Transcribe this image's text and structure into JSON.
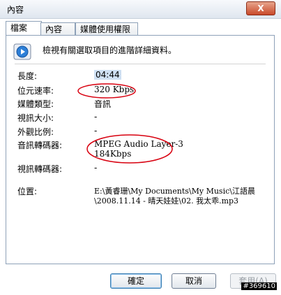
{
  "window": {
    "title": "內容",
    "close_glyph": "X"
  },
  "tabs": [
    {
      "label": "檔案",
      "active": true
    },
    {
      "label": "內容",
      "active": false
    },
    {
      "label": "媒體使用權限",
      "active": false
    }
  ],
  "panel": {
    "description": "檢視有關選取項目的進階詳細資料。",
    "icon": "media-player-icon",
    "rows": [
      {
        "label": "長度:",
        "value": "04:44"
      },
      {
        "label": "位元速率:",
        "value": "320 Kbps"
      },
      {
        "label": "媒體類型:",
        "value": "音訊"
      },
      {
        "label": "視訊大小:",
        "value": "-"
      },
      {
        "label": "外觀比例:",
        "value": "-"
      },
      {
        "label": "音訊轉碼器:",
        "value": "MPEG Audio Layer-3",
        "value2": "184Kbps"
      },
      {
        "label": "視訊轉碼器:",
        "value": "-"
      },
      {
        "label": "位置:",
        "value": "E:\\黃睿珊\\My Documents\\My Music\\江語晨",
        "value2": "\\2008.11.14 - 晴天娃娃\\02. 我太乖.mp3"
      }
    ]
  },
  "buttons": {
    "ok": "確定",
    "cancel": "取消",
    "apply": "套用(A)"
  },
  "watermark": "#369610",
  "colors": {
    "annotation": "#d8000f",
    "accent": "#3c7fb1"
  }
}
